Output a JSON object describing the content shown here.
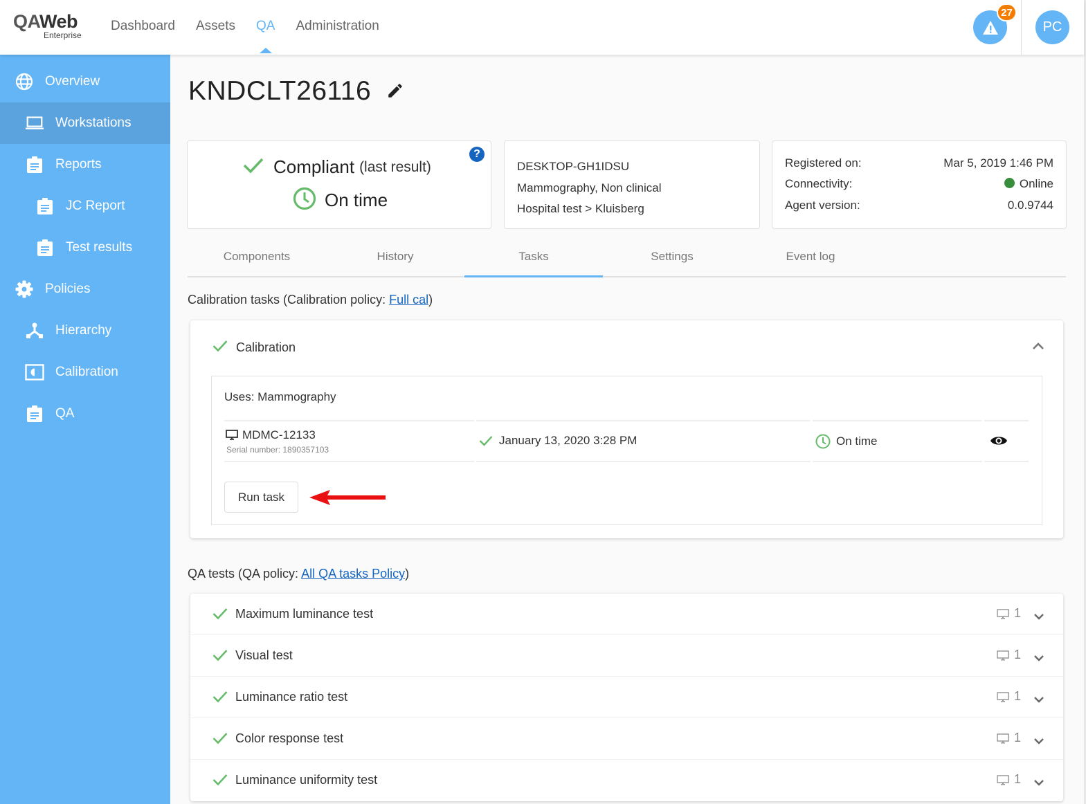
{
  "header": {
    "logo_main_a": "QA",
    "logo_main_b": "Web",
    "logo_sub": "Enterprise",
    "nav": [
      {
        "label": "Dashboard",
        "active": false
      },
      {
        "label": "Assets",
        "active": false
      },
      {
        "label": "QA",
        "active": true
      },
      {
        "label": "Administration",
        "active": false
      }
    ],
    "alerts_count": "27",
    "alert_icon": "warning-icon",
    "user_initials": "PC",
    "accent_color": "#64b5f6",
    "badge_color": "#f57c00"
  },
  "sidebar": {
    "items": [
      {
        "label": "Overview",
        "icon": "globe-icon",
        "active": false
      },
      {
        "label": "Workstations",
        "icon": "laptop-icon",
        "active": true
      },
      {
        "label": "Reports",
        "icon": "clipboard-icon",
        "active": false
      },
      {
        "label": "JC Report",
        "icon": "clipboard-icon",
        "active": false
      },
      {
        "label": "Test results",
        "icon": "clipboard-icon",
        "active": false
      },
      {
        "label": "Policies",
        "icon": "gear-icon",
        "active": false
      },
      {
        "label": "Hierarchy",
        "icon": "hierarchy-icon",
        "active": false
      },
      {
        "label": "Calibration",
        "icon": "calibration-icon",
        "active": false
      },
      {
        "label": "QA",
        "icon": "clipboard-icon",
        "active": false
      }
    ]
  },
  "workstation": {
    "name": "KNDCLT26116",
    "status": {
      "compliance": "Compliant",
      "compliance_note": "(last result)",
      "schedule": "On time",
      "help": "?"
    },
    "info": {
      "hostname": "DESKTOP-GH1IDSU",
      "usage": "Mammography, Non clinical",
      "location": "Hospital test > Kluisberg"
    },
    "meta": {
      "registered_label": "Registered on:",
      "registered_value": "Mar 5, 2019 1:46 PM",
      "connectivity_label": "Connectivity:",
      "connectivity_value": "Online",
      "connectivity_color": "#388e3c",
      "agent_label": "Agent version:",
      "agent_value": "0.0.9744"
    }
  },
  "tabs": [
    {
      "label": "Components",
      "active": false
    },
    {
      "label": "History",
      "active": false
    },
    {
      "label": "Tasks",
      "active": true
    },
    {
      "label": "Settings",
      "active": false
    },
    {
      "label": "Event log",
      "active": false
    }
  ],
  "calibration": {
    "section_prefix": "Calibration tasks (Calibration policy: ",
    "policy_link": "Full cal",
    "section_suffix": ")",
    "task_title": "Calibration",
    "uses": "Uses: Mammography",
    "row": {
      "display": "MDMC-12133",
      "serial": "Serial number: 1890357103",
      "date": "January 13, 2020 3:28 PM",
      "schedule": "On time"
    },
    "run_button": "Run task"
  },
  "qa": {
    "section_prefix": "QA tests (QA policy: ",
    "policy_link": "All QA tasks Policy",
    "section_suffix": ")",
    "tests": [
      {
        "label": "Maximum luminance test",
        "count": "1"
      },
      {
        "label": "Visual test",
        "count": "1"
      },
      {
        "label": "Luminance ratio test",
        "count": "1"
      },
      {
        "label": "Color response test",
        "count": "1"
      },
      {
        "label": "Luminance uniformity test",
        "count": "1"
      }
    ]
  }
}
